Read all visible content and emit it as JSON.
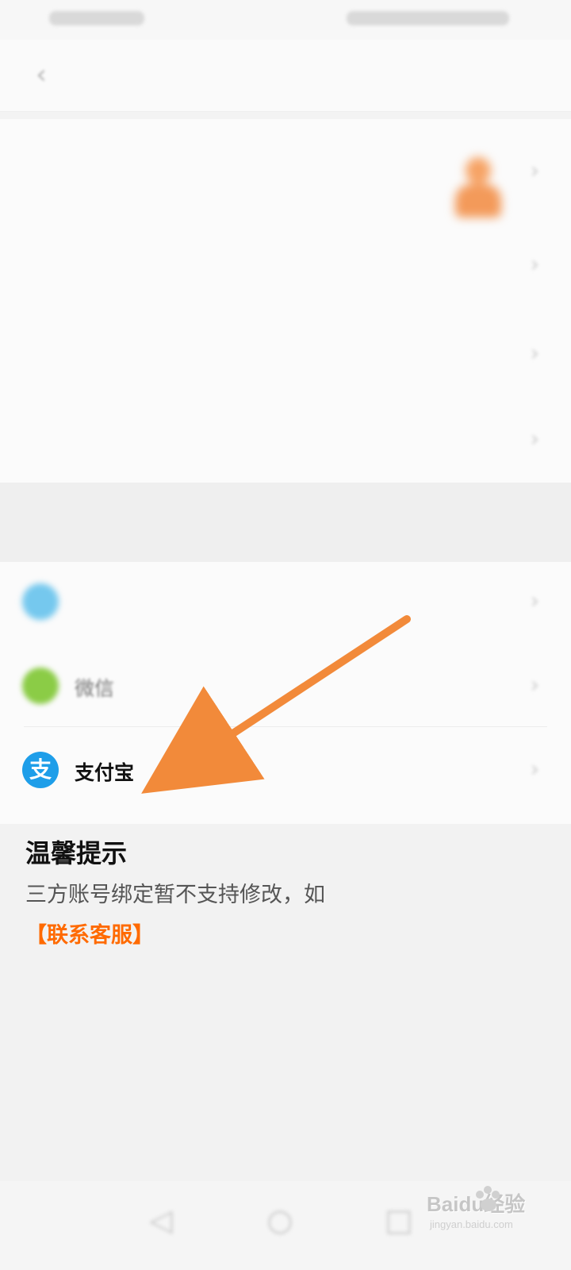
{
  "status_bar": {
    "left": "",
    "right": ""
  },
  "header": {
    "title": ""
  },
  "settings": [
    {
      "label": "",
      "value": ""
    },
    {
      "label": "",
      "value": ""
    },
    {
      "label": "",
      "value": ""
    },
    {
      "label": "",
      "value": ""
    }
  ],
  "bind_section": {
    "title": "",
    "items": [
      {
        "label": "",
        "value": ""
      },
      {
        "label": "微信",
        "value": ""
      },
      {
        "label": "支付宝",
        "value": ""
      }
    ]
  },
  "tips": {
    "title": "温馨提示",
    "text_clear": "三方账号绑定暂不支持修改，如",
    "text_blur": "",
    "link": "【联系客服】"
  },
  "watermark": {
    "brand": "Baidu经验",
    "domain": "jingyan.baidu.com"
  },
  "colors": {
    "accent": "#ff6a00",
    "alipay": "#1e9ee9",
    "wechat": "#8bcc46"
  },
  "icons": {
    "back": "chevron-left-icon",
    "alipay": "alipay-icon",
    "wechat": "wechat-icon",
    "phone": "phone-icon"
  }
}
